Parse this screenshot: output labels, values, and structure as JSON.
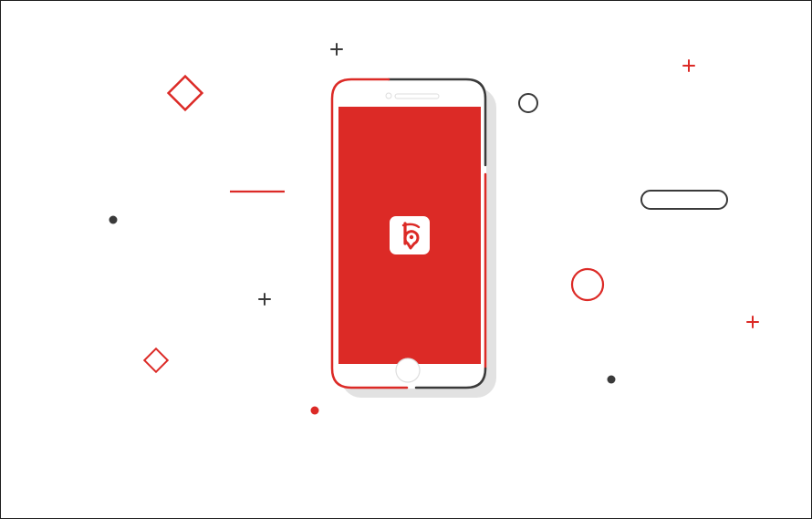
{
  "illustration": {
    "accent_color": "#dc2a26",
    "dark_color": "#3a3a3a",
    "shadow_color": "#e2e2e2",
    "screen_color": "#dc2a26",
    "phone_body_color": "#ffffff",
    "app_icon": {
      "name": "b-location-pin-app-icon",
      "glyph_color": "#dc2a26",
      "background": "#ffffff"
    },
    "shapes": [
      "plus-icon",
      "plus-icon",
      "plus-icon",
      "plus-icon",
      "ring-icon",
      "ring-icon",
      "diamond-outline",
      "diamond-outline",
      "dot",
      "dot",
      "dot",
      "line",
      "pill-outline"
    ]
  }
}
